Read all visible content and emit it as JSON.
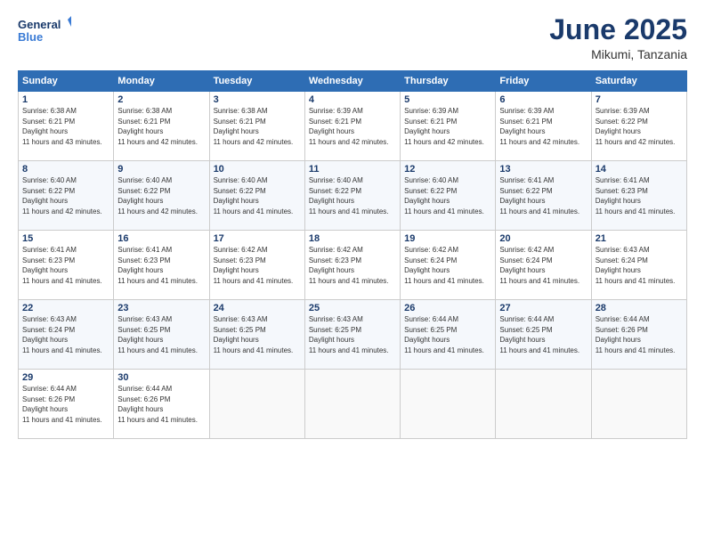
{
  "header": {
    "logo_line1": "General",
    "logo_line2": "Blue",
    "month": "June 2025",
    "location": "Mikumi, Tanzania"
  },
  "weekdays": [
    "Sunday",
    "Monday",
    "Tuesday",
    "Wednesday",
    "Thursday",
    "Friday",
    "Saturday"
  ],
  "weeks": [
    [
      {
        "day": "1",
        "rise": "6:38 AM",
        "set": "6:21 PM",
        "hours": "11 hours and 43 minutes."
      },
      {
        "day": "2",
        "rise": "6:38 AM",
        "set": "6:21 PM",
        "hours": "11 hours and 42 minutes."
      },
      {
        "day": "3",
        "rise": "6:38 AM",
        "set": "6:21 PM",
        "hours": "11 hours and 42 minutes."
      },
      {
        "day": "4",
        "rise": "6:39 AM",
        "set": "6:21 PM",
        "hours": "11 hours and 42 minutes."
      },
      {
        "day": "5",
        "rise": "6:39 AM",
        "set": "6:21 PM",
        "hours": "11 hours and 42 minutes."
      },
      {
        "day": "6",
        "rise": "6:39 AM",
        "set": "6:21 PM",
        "hours": "11 hours and 42 minutes."
      },
      {
        "day": "7",
        "rise": "6:39 AM",
        "set": "6:22 PM",
        "hours": "11 hours and 42 minutes."
      }
    ],
    [
      {
        "day": "8",
        "rise": "6:40 AM",
        "set": "6:22 PM",
        "hours": "11 hours and 42 minutes."
      },
      {
        "day": "9",
        "rise": "6:40 AM",
        "set": "6:22 PM",
        "hours": "11 hours and 42 minutes."
      },
      {
        "day": "10",
        "rise": "6:40 AM",
        "set": "6:22 PM",
        "hours": "11 hours and 41 minutes."
      },
      {
        "day": "11",
        "rise": "6:40 AM",
        "set": "6:22 PM",
        "hours": "11 hours and 41 minutes."
      },
      {
        "day": "12",
        "rise": "6:40 AM",
        "set": "6:22 PM",
        "hours": "11 hours and 41 minutes."
      },
      {
        "day": "13",
        "rise": "6:41 AM",
        "set": "6:22 PM",
        "hours": "11 hours and 41 minutes."
      },
      {
        "day": "14",
        "rise": "6:41 AM",
        "set": "6:23 PM",
        "hours": "11 hours and 41 minutes."
      }
    ],
    [
      {
        "day": "15",
        "rise": "6:41 AM",
        "set": "6:23 PM",
        "hours": "11 hours and 41 minutes."
      },
      {
        "day": "16",
        "rise": "6:41 AM",
        "set": "6:23 PM",
        "hours": "11 hours and 41 minutes."
      },
      {
        "day": "17",
        "rise": "6:42 AM",
        "set": "6:23 PM",
        "hours": "11 hours and 41 minutes."
      },
      {
        "day": "18",
        "rise": "6:42 AM",
        "set": "6:23 PM",
        "hours": "11 hours and 41 minutes."
      },
      {
        "day": "19",
        "rise": "6:42 AM",
        "set": "6:24 PM",
        "hours": "11 hours and 41 minutes."
      },
      {
        "day": "20",
        "rise": "6:42 AM",
        "set": "6:24 PM",
        "hours": "11 hours and 41 minutes."
      },
      {
        "day": "21",
        "rise": "6:43 AM",
        "set": "6:24 PM",
        "hours": "11 hours and 41 minutes."
      }
    ],
    [
      {
        "day": "22",
        "rise": "6:43 AM",
        "set": "6:24 PM",
        "hours": "11 hours and 41 minutes."
      },
      {
        "day": "23",
        "rise": "6:43 AM",
        "set": "6:25 PM",
        "hours": "11 hours and 41 minutes."
      },
      {
        "day": "24",
        "rise": "6:43 AM",
        "set": "6:25 PM",
        "hours": "11 hours and 41 minutes."
      },
      {
        "day": "25",
        "rise": "6:43 AM",
        "set": "6:25 PM",
        "hours": "11 hours and 41 minutes."
      },
      {
        "day": "26",
        "rise": "6:44 AM",
        "set": "6:25 PM",
        "hours": "11 hours and 41 minutes."
      },
      {
        "day": "27",
        "rise": "6:44 AM",
        "set": "6:25 PM",
        "hours": "11 hours and 41 minutes."
      },
      {
        "day": "28",
        "rise": "6:44 AM",
        "set": "6:26 PM",
        "hours": "11 hours and 41 minutes."
      }
    ],
    [
      {
        "day": "29",
        "rise": "6:44 AM",
        "set": "6:26 PM",
        "hours": "11 hours and 41 minutes."
      },
      {
        "day": "30",
        "rise": "6:44 AM",
        "set": "6:26 PM",
        "hours": "11 hours and 41 minutes."
      },
      null,
      null,
      null,
      null,
      null
    ]
  ]
}
